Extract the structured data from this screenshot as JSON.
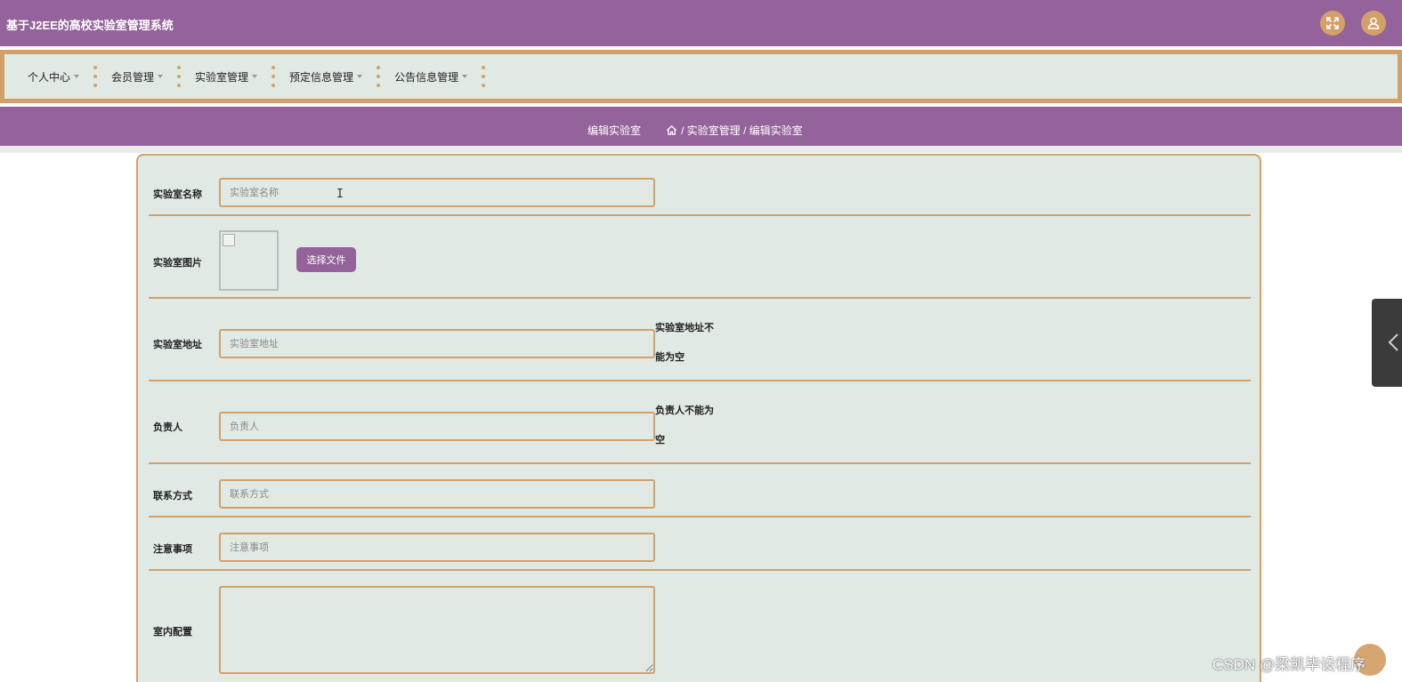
{
  "app": {
    "title": "基于J2EE的高校实验室管理系统"
  },
  "header": {
    "fullscreen_icon": "fullscreen-icon",
    "user_icon": "user-icon"
  },
  "menu": {
    "items": [
      {
        "label": "个人中心"
      },
      {
        "label": "会员管理"
      },
      {
        "label": "实验室管理"
      },
      {
        "label": "预定信息管理"
      },
      {
        "label": "公告信息管理"
      }
    ]
  },
  "breadcrumb": {
    "title": "编辑实验室",
    "home_icon": "home-icon",
    "path": "/ 实验室管理 / 编辑实验室"
  },
  "form": {
    "name": {
      "label": "实验室名称",
      "placeholder": "实验室名称",
      "value": ""
    },
    "image": {
      "label": "实验室图片",
      "button": "选择文件"
    },
    "address": {
      "label": "实验室地址",
      "placeholder": "实验室地址",
      "value": "",
      "error": "实验室地址不能为空"
    },
    "manager": {
      "label": "负责人",
      "placeholder": "负责人",
      "value": "",
      "error": "负责人不能为空"
    },
    "contact": {
      "label": "联系方式",
      "placeholder": "联系方式",
      "value": ""
    },
    "notes": {
      "label": "注意事项",
      "placeholder": "注意事项",
      "value": ""
    },
    "config": {
      "label": "室内配置",
      "value": ""
    }
  },
  "watermark": "CSDN @梁凯毕设程序",
  "colors": {
    "purple": "#95639b",
    "tan": "#d4a06a",
    "panel": "#e1e9e5"
  }
}
